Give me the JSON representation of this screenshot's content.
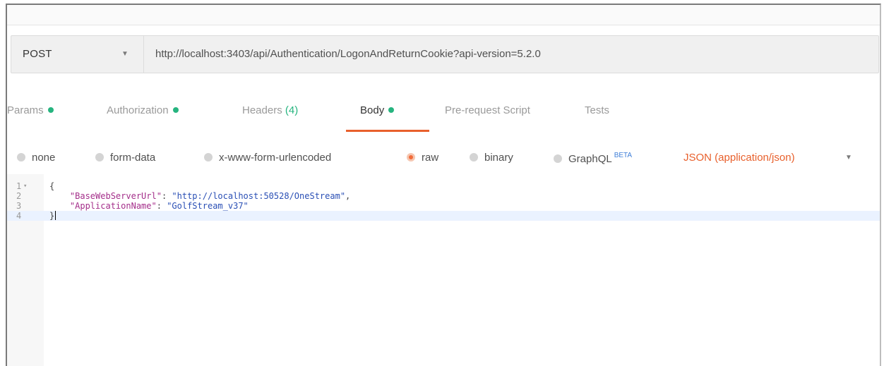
{
  "request": {
    "method": "POST",
    "url": "http://localhost:3403/api/Authentication/LogonAndReturnCookie?api-version=5.2.0"
  },
  "tabs": [
    {
      "label": "Params",
      "indicator": true
    },
    {
      "label": "Authorization",
      "indicator": true
    },
    {
      "label": "Headers",
      "count": "(4)"
    },
    {
      "label": "Body",
      "indicator": true,
      "active": true
    },
    {
      "label": "Pre-request Script"
    },
    {
      "label": "Tests"
    }
  ],
  "body_options": {
    "none": "none",
    "form_data": "form-data",
    "urlencoded": "x-www-form-urlencoded",
    "raw": "raw",
    "binary": "binary",
    "graphql": "GraphQL",
    "beta": "BETA",
    "selected": "raw",
    "content_type": "JSON (application/json)"
  },
  "editor": {
    "line_numbers": [
      "1",
      "2",
      "3",
      "4"
    ],
    "lines": [
      {
        "open": "{"
      },
      {
        "key": "\"BaseWebServerUrl\"",
        "sep": ": ",
        "value": "\"http://localhost:50528/OneStream\"",
        "tail": ","
      },
      {
        "key": "\"ApplicationName\"",
        "sep": ": ",
        "value": "\"GolfStream_v37\"",
        "tail": ""
      },
      {
        "close": "}"
      }
    ]
  },
  "colors": {
    "accent": "#e8602c",
    "indicator": "#26b47f",
    "beta": "#3f7fd8",
    "json_key": "#a42e8a",
    "json_string": "#2a4fb5"
  },
  "icons": {
    "method_dropdown": "chevron-down-icon",
    "content_type_dropdown": "chevron-down-icon",
    "fold": "fold-caret-icon"
  }
}
